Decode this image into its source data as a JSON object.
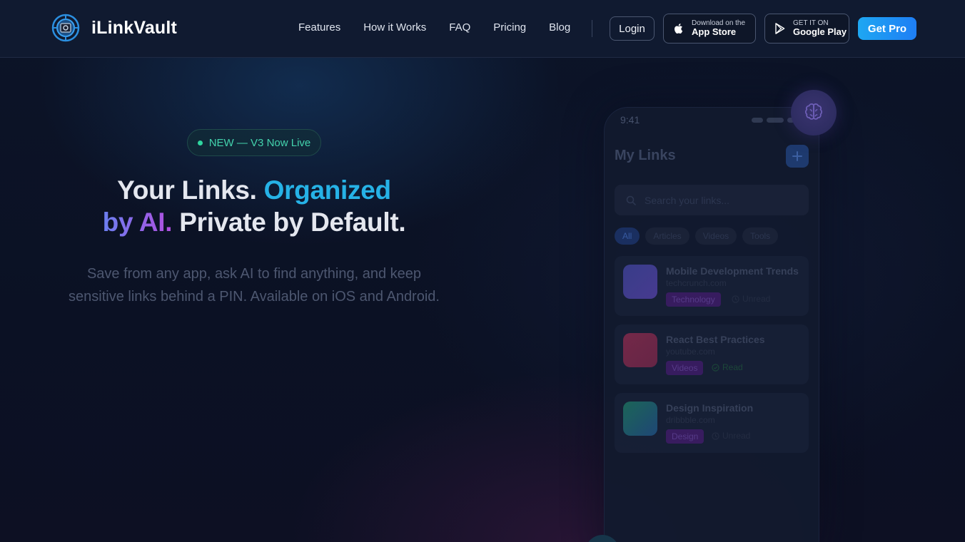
{
  "nav": {
    "brand": "iLinkVault",
    "links": [
      "Features",
      "How it Works",
      "FAQ",
      "Pricing",
      "Blog"
    ],
    "login": "Login",
    "app_store": {
      "small": "Download on the",
      "big": "App Store"
    },
    "google_play": {
      "small": "GET IT ON",
      "big": "Google Play"
    },
    "cta": "Get Pro"
  },
  "hero": {
    "badge": "NEW — V3 Now Live",
    "headline": {
      "part1": "Your Links. ",
      "part2": "Organized",
      "part3": "by AI.",
      "part4": " Private by Default."
    },
    "subtitle_line1": "Save from any app, ask AI to find anything, and keep",
    "subtitle_line2": "sensitive links behind a PIN. Available on iOS and Android."
  },
  "phone": {
    "time": "9:41",
    "title": "My Links",
    "search_placeholder": "Search your links...",
    "chips": [
      "All",
      "Articles",
      "Videos",
      "Tools"
    ],
    "active_chip": "All",
    "cards": [
      {
        "title": "Mobile Development Trends",
        "domain": "techcrunch.com",
        "tag": "Technology",
        "status": "Unread",
        "thumb": [
          "#3b3f8e",
          "#4a3c96"
        ]
      },
      {
        "title": "React Best Practices",
        "domain": "youtube.com",
        "tag": "Videos",
        "status": "Read",
        "thumb": [
          "#7a2a4a",
          "#6a2648"
        ]
      },
      {
        "title": "Design Inspiration",
        "domain": "dribbble.com",
        "tag": "Design",
        "status": "Unread",
        "thumb": [
          "#1d6a5a",
          "#1f4a7a"
        ]
      }
    ]
  },
  "colors": {
    "accent": "#1e8ef5",
    "badge_green": "#43d3ad",
    "headline_blue": "#26b2e6",
    "headline_purple": "#9a5ee6"
  }
}
